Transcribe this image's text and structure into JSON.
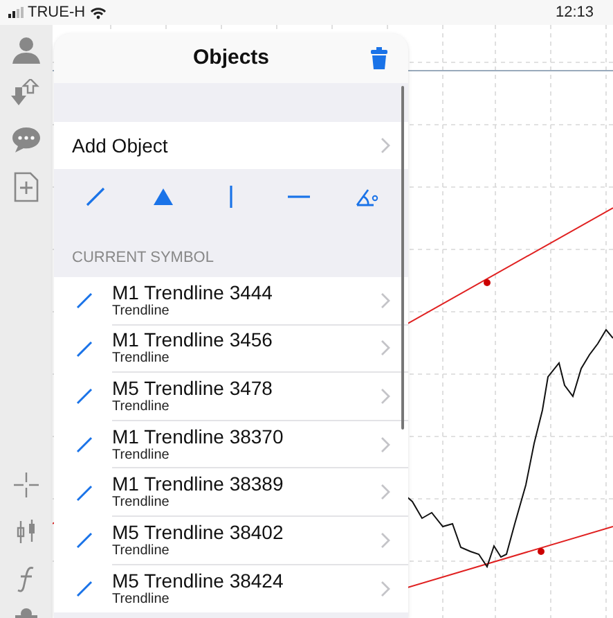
{
  "status_bar": {
    "carrier": "TRUE-H",
    "time": "12:13"
  },
  "panel": {
    "title": "Objects",
    "add_object": "Add Object",
    "tools": [
      {
        "kind": "trendline"
      },
      {
        "kind": "triangle"
      },
      {
        "kind": "vertical"
      },
      {
        "kind": "horizontal"
      },
      {
        "kind": "angle"
      }
    ],
    "section_header": "CURRENT SYMBOL",
    "objects": [
      {
        "name": "M1 Trendline 3444",
        "type": "Trendline"
      },
      {
        "name": "M1 Trendline 3456",
        "type": "Trendline"
      },
      {
        "name": "M5 Trendline 3478",
        "type": "Trendline"
      },
      {
        "name": "M1 Trendline 38370",
        "type": "Trendline"
      },
      {
        "name": "M1 Trendline 38389",
        "type": "Trendline"
      },
      {
        "name": "M5 Trendline 38402",
        "type": "Trendline"
      },
      {
        "name": "M5 Trendline 38424",
        "type": "Trendline"
      }
    ]
  }
}
